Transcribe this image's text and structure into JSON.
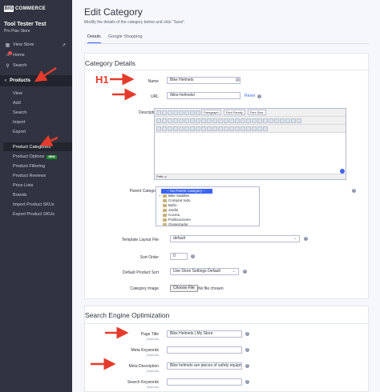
{
  "sidebar": {
    "logo_mark": "BIG",
    "logo_text": "COMMERCE",
    "store_name": "Tool Tester Test",
    "store_plan": "Pro Plan Store",
    "view_store": "View Store",
    "home": "Home",
    "search": "Search",
    "products": "Products",
    "sub_items": [
      "View",
      "Add",
      "Search",
      "Import",
      "Export"
    ],
    "active_item": "Product Categories",
    "options_item": "Product Options",
    "options_badge": "NEW",
    "more_items": [
      "Product Filtering",
      "Product Reviews",
      "Price Lists",
      "Brands",
      "Import Product SKUs",
      "Export Product SKUs"
    ]
  },
  "header": {
    "title": "Edit Category",
    "subtitle": "Modify the details of the category below and click \"Save\".",
    "tabs": [
      "Details",
      "Google Shopping"
    ]
  },
  "category_details": {
    "section_title": "Category Details",
    "name_label": "Name",
    "name_value": "Bike Helmets",
    "url_label": "URL",
    "url_value": "/bike-helmets/",
    "reset_link": "Reset",
    "description_label": "Description",
    "editor_paragraph": "Paragraph",
    "editor_font_family": "Font Family",
    "editor_font_size": "Font Size",
    "editor_path": "Path: p",
    "parent_label": "Parent Category",
    "parent_selected": "-- No Parent Category --",
    "parent_items": [
      "Bike Saddles",
      "Comprar todo",
      "Baño",
      "Jardin",
      "Cocina",
      "Publicaciones",
      "Organizador"
    ],
    "template_label": "Template Layout File",
    "template_value": "default",
    "sort_label": "Sort Order",
    "sort_value": "0",
    "default_sort_label": "Default Product Sort",
    "default_sort_value": "Use Store Settings Default",
    "image_label": "Category Image",
    "choose_file": "Choose File",
    "no_file": "No file chosen"
  },
  "seo": {
    "section_title": "Search Engine Optimization",
    "page_title_label": "Page Title",
    "page_title_value": "Bike Helmets | My Store",
    "meta_keywords_label": "Meta Keywords",
    "meta_description_label": "Meta Description",
    "meta_description_value": "Bike helmets are pieces of safety equipm",
    "search_keywords_label": "Search Keywords",
    "optional": "(Optional)"
  },
  "annotation": {
    "h1_text": "H1",
    "color": "#e53b2c"
  }
}
